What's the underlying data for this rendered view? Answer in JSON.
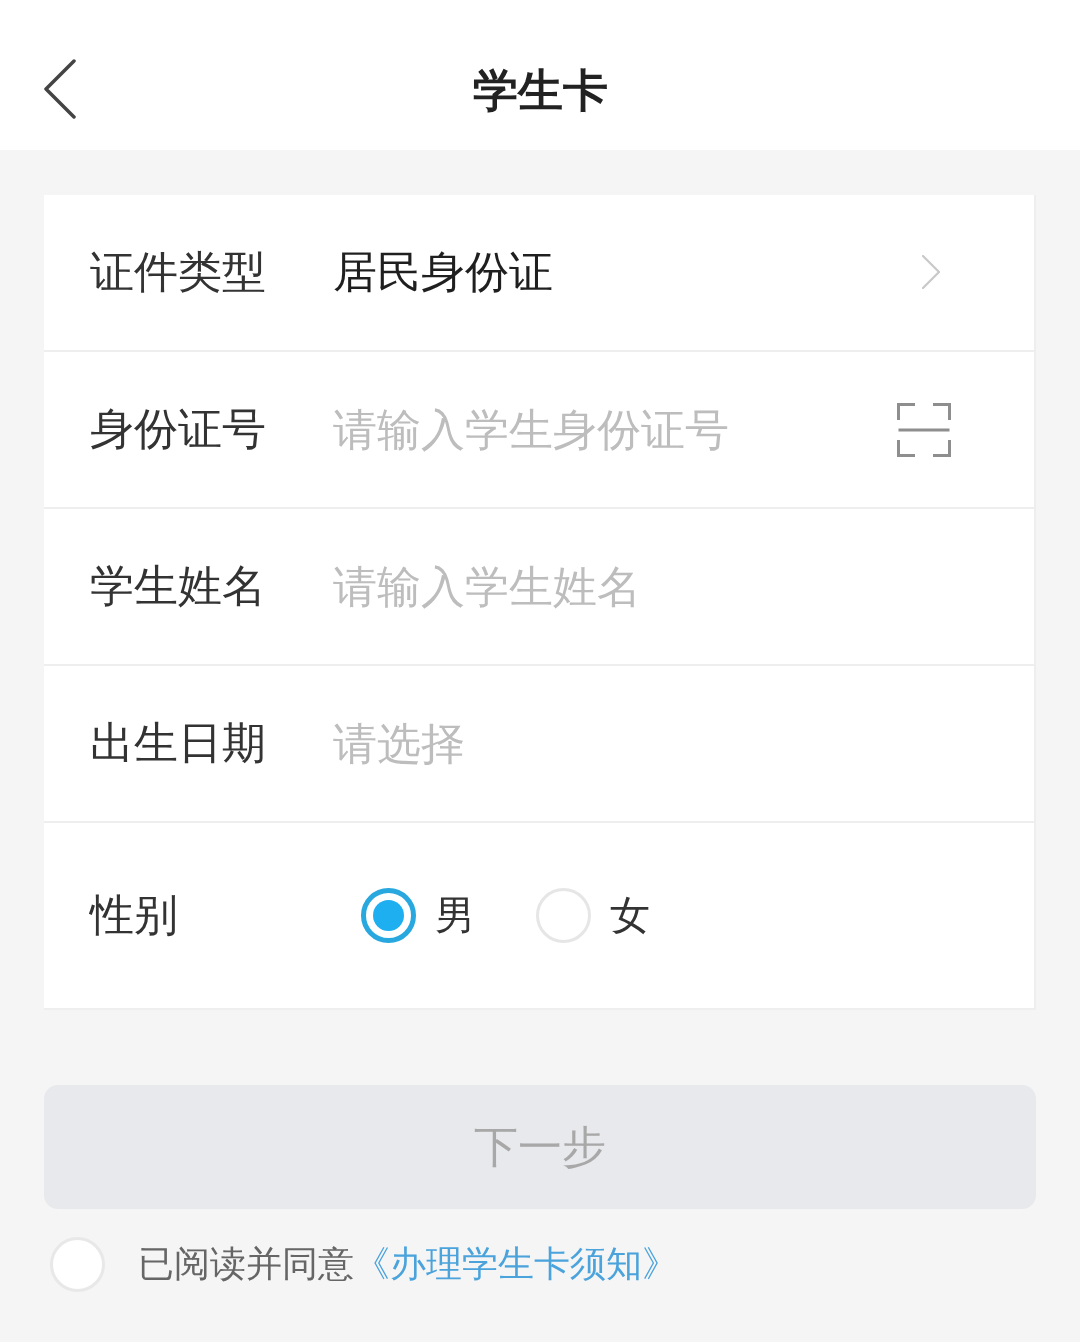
{
  "header": {
    "title": "学生卡"
  },
  "form": {
    "fields": [
      {
        "kind": "select",
        "label": "证件类型",
        "value": "居民身份证"
      },
      {
        "kind": "scan",
        "label": "身份证号",
        "placeholder": "请输入学生身份证号"
      },
      {
        "kind": "input",
        "label": "学生姓名",
        "placeholder": "请输入学生姓名"
      },
      {
        "kind": "picker",
        "label": "出生日期",
        "placeholder": "请选择"
      },
      {
        "kind": "radio",
        "label": "性别",
        "options": [
          {
            "label": "男",
            "selected": true
          },
          {
            "label": "女",
            "selected": false
          }
        ]
      }
    ]
  },
  "next_button": {
    "label": "下一步",
    "disabled": true
  },
  "agreement": {
    "checked": false,
    "text": "已阅读并同意",
    "link": "《办理学生卡须知》"
  }
}
